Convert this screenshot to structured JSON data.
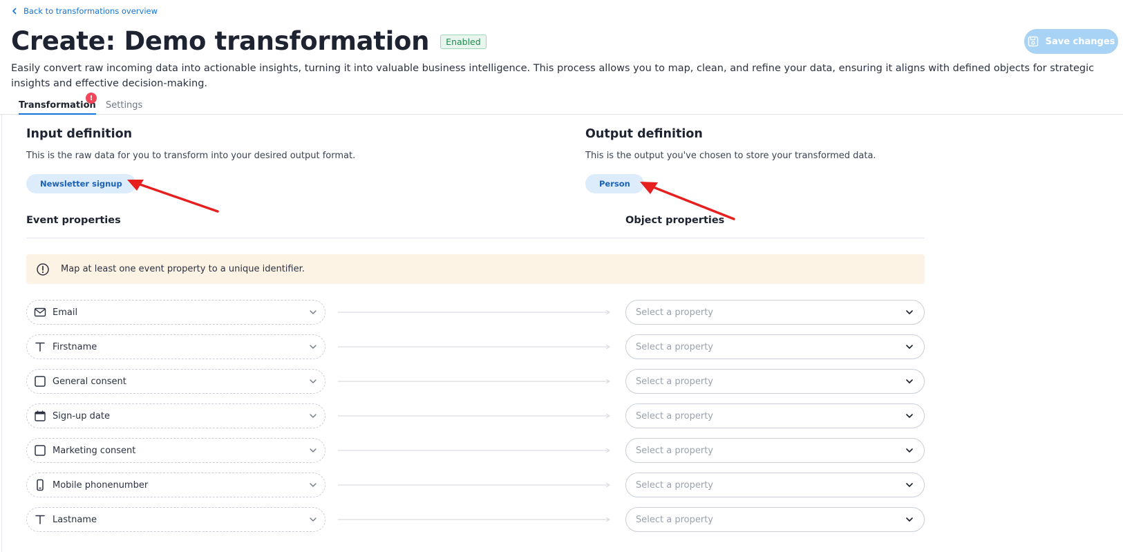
{
  "nav": {
    "back_label": "Back to transformations overview"
  },
  "header": {
    "title": "Create: Demo transformation",
    "status": "Enabled",
    "save_label": "Save changes",
    "description": "Easily convert raw incoming data into actionable insights, turning it into valuable business intelligence. This process allows you to map, clean, and refine your data, ensuring it aligns with defined objects for strategic insights and effective decision-making."
  },
  "tabs": [
    {
      "label": "Transformation",
      "active": true,
      "error_badge": "!"
    },
    {
      "label": "Settings",
      "active": false
    }
  ],
  "input": {
    "title": "Input definition",
    "description": "This is the raw data for you to transform into your desired output format.",
    "pill": "Newsletter signup"
  },
  "output": {
    "title": "Output definition",
    "description": "This is the output you've chosen to store your transformed data.",
    "pill": "Person"
  },
  "columns": {
    "event_header": "Event properties",
    "object_header": "Object properties"
  },
  "warning": {
    "text": "Map at least one event property to a unique identifier.",
    "icon": "alert-circle-icon"
  },
  "mappings": [
    {
      "event": "Email",
      "icon": "mail-icon",
      "placeholder": "Select a property"
    },
    {
      "event": "Firstname",
      "icon": "text-type-icon",
      "placeholder": "Select a property"
    },
    {
      "event": "General consent",
      "icon": "checkbox-icon",
      "placeholder": "Select a property"
    },
    {
      "event": "Sign-up date",
      "icon": "calendar-icon",
      "placeholder": "Select a property"
    },
    {
      "event": "Marketing consent",
      "icon": "checkbox-icon",
      "placeholder": "Select a property"
    },
    {
      "event": "Mobile phonenumber",
      "icon": "phone-icon",
      "placeholder": "Select a property"
    },
    {
      "event": "Lastname",
      "icon": "text-type-icon",
      "placeholder": "Select a property"
    }
  ],
  "colors": {
    "accent": "#1473d6",
    "enabled": "#1d8a4f",
    "warning_bg": "#fdf3e4",
    "error": "#f0475a",
    "annotation": "#e5201f"
  }
}
